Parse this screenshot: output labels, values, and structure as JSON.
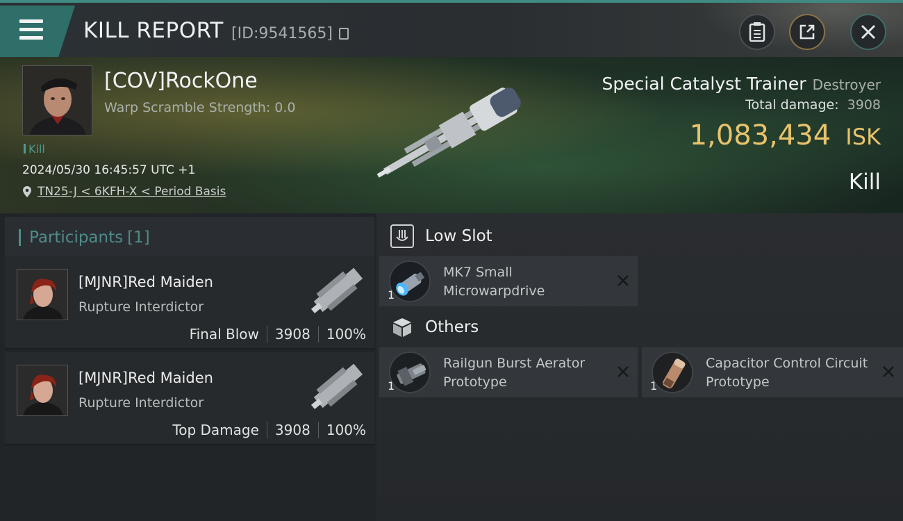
{
  "header": {
    "title": "KILL REPORT",
    "report_id": "[ID:9541565]"
  },
  "victim": {
    "name": "[COV]RockOne",
    "scramble": "Warp Scramble Strength: 0.0",
    "kill_tag": "Kill",
    "timestamp": "2024/05/30 16:45:57 UTC +1",
    "location": "TN25-J < 6KFH-X < Period Basis",
    "ship_name": "Special Catalyst Trainer",
    "ship_class": "Destroyer",
    "total_damage_label": "Total damage:",
    "total_damage_value": "3908",
    "isk_value": "1,083,434",
    "isk_unit": "ISK",
    "result": "Kill"
  },
  "participants": {
    "label": "Participants",
    "count": "[1]",
    "rows": [
      {
        "name": "[MJNR]Red Maiden",
        "ship": "Rupture Interdictor",
        "role": "Final Blow",
        "damage": "3908",
        "percent": "100%"
      },
      {
        "name": "[MJNR]Red Maiden",
        "ship": "Rupture Interdictor",
        "role": "Top Damage",
        "damage": "3908",
        "percent": "100%"
      }
    ]
  },
  "fitting": {
    "low_slot_title": "Low Slot",
    "others_title": "Others",
    "low_slot_items": [
      {
        "qty": "1",
        "name": "MK7 Small Microwarpdrive"
      }
    ],
    "other_items": [
      {
        "qty": "1",
        "name": "Railgun Burst Aerator Prototype"
      },
      {
        "qty": "1",
        "name": "Capacitor Control Circuit Prototype"
      }
    ]
  },
  "colors": {
    "accent_teal": "#3f8a82",
    "isk_gold": "#e8c36c"
  },
  "icons": [
    "menu-icon",
    "copy-icon",
    "clipboard-icon",
    "share-icon",
    "close-icon",
    "location-pin-icon",
    "low-slot-icon",
    "others-cube-icon",
    "remove-x-icon"
  ]
}
